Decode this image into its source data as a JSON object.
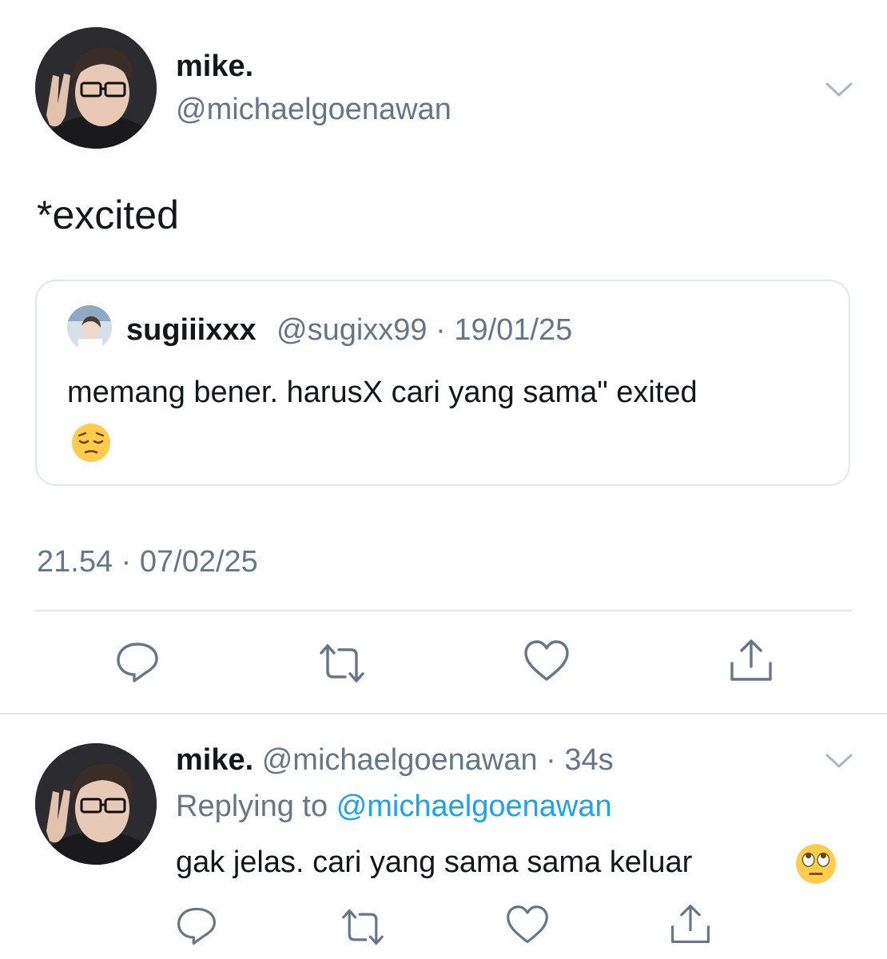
{
  "main_tweet": {
    "author_name": "mike.",
    "author_handle": "@michaelgoenawan",
    "text": "*excited",
    "timestamp": "21.54 · 07/02/25",
    "avatar_icon": "user-avatar-icon",
    "menu_icon": "chevron-down-icon"
  },
  "quoted_tweet": {
    "author_name": "sugiiixxx",
    "author_handle": "@sugixx99",
    "date": "19/01/25",
    "meta": "@sugixx99 · 19/01/25",
    "text": "memang bener. harusX cari yang sama\" exited",
    "emoji_icon": "pensive-face-icon"
  },
  "actions": [
    {
      "name": "reply-button",
      "icon": "reply-icon"
    },
    {
      "name": "retweet-button",
      "icon": "retweet-icon"
    },
    {
      "name": "like-button",
      "icon": "heart-icon"
    },
    {
      "name": "share-button",
      "icon": "share-icon"
    }
  ],
  "reply_tweet": {
    "author_name": "mike.",
    "author_handle": "@michaelgoenawan",
    "time_ago": "34s",
    "meta": "@michaelgoenawan · 34s",
    "replying_label": "Replying to",
    "replying_handle": "@michaelgoenawan",
    "text": "gak jelas. cari yang sama sama keluar",
    "emoji_icon": "rolling-eyes-face-icon"
  },
  "colors": {
    "text": "#14171a",
    "muted": "#657786",
    "link": "#1da1f2",
    "border": "#e1e8ed"
  }
}
